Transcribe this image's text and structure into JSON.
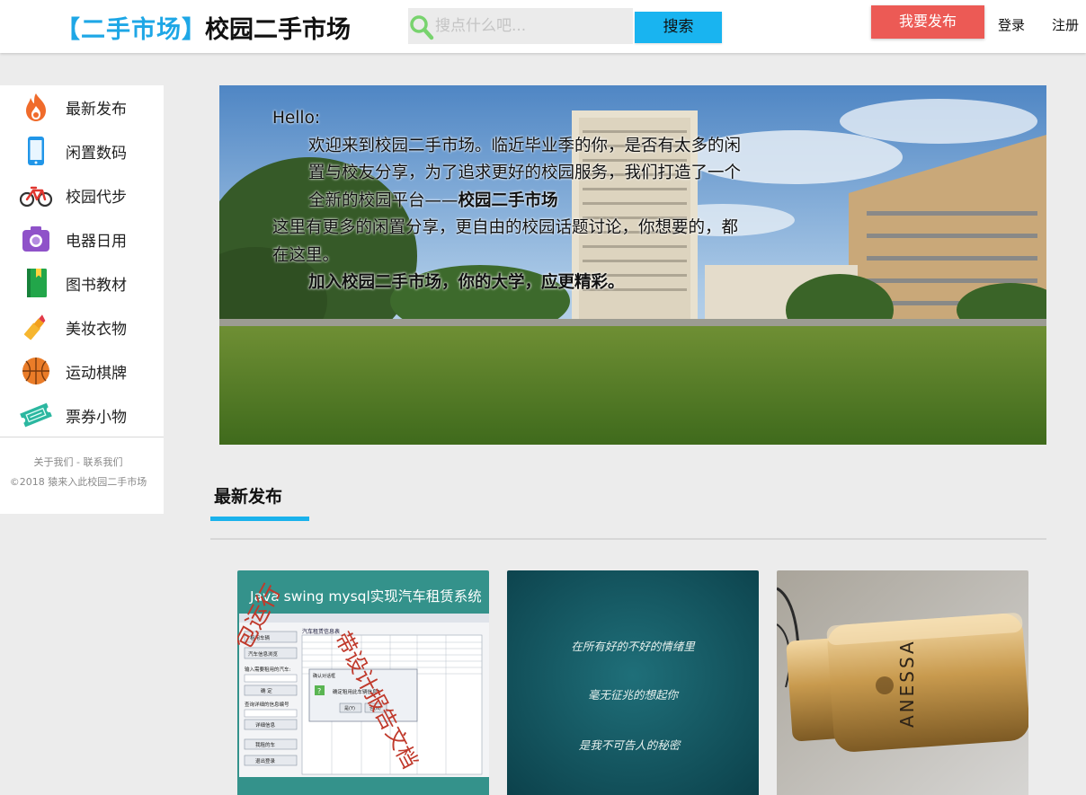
{
  "header": {
    "logo_bracket": "【二手市场】",
    "site_title": "校园二手市场",
    "search_placeholder": "搜点什么吧...",
    "search_button": "搜索",
    "publish_button": "我要发布",
    "login": "登录",
    "register": "注册"
  },
  "sidebar": {
    "categories": [
      {
        "label": "最新发布",
        "icon": "flame-icon"
      },
      {
        "label": "闲置数码",
        "icon": "phone-icon"
      },
      {
        "label": "校园代步",
        "icon": "bicycle-icon"
      },
      {
        "label": "电器日用",
        "icon": "camera-icon"
      },
      {
        "label": "图书教材",
        "icon": "book-icon"
      },
      {
        "label": "美妆衣物",
        "icon": "lipstick-icon"
      },
      {
        "label": "运动棋牌",
        "icon": "basketball-icon"
      },
      {
        "label": "票券小物",
        "icon": "ticket-icon"
      }
    ],
    "footer_links": "关于我们 - 联系我们",
    "copyright": "©2018 猿来入此校园二手市场"
  },
  "banner": {
    "greeting": "Hello:",
    "para1": "欢迎来到校园二手市场。临近毕业季的你，是否有太多的闲置与校友分享，为了追求更好的校园服务，我们打造了一个全新的校园平台——",
    "para1_bold": "校园二手市场",
    "para2": "这里有更多的闲置分享，更自由的校园话题讨论，你想要的，都在这里。",
    "para3": "加入校园二手市场，你的大学，应更精彩。"
  },
  "section": {
    "title": "最新发布"
  },
  "products": [
    {
      "thumb_title": "Java swing mysql实现汽车租赁系统",
      "watermark_left": "包运行",
      "watermark_right": "带设计报告文档",
      "dialog_title": "确认对话框",
      "dialog_message": "确定租用此车辆信息?",
      "dialog_ok": "是(Y)",
      "dialog_no": "否(N)",
      "app_title": "汽车租赁信息表",
      "btn_rent": "租用车辆",
      "btn_browse": "汽车信息浏览",
      "field_label": "输入需要租用的汽车:",
      "btn_confirm": "确 定",
      "query_label": "查询详细的信息编号",
      "btn_detail": "详细信息",
      "btn_return": "我租的车",
      "btn_exit": "退出登录"
    },
    {
      "line1": "在所有好的不好的情绪里",
      "line2": "毫无征兆的想起你",
      "line3": "是我不可告人的秘密"
    },
    {
      "brand": "ANESSA"
    }
  ],
  "colors": {
    "accent_blue": "#1ab2ec",
    "publish_red": "#ec5a55",
    "page_bg": "#ececec"
  }
}
